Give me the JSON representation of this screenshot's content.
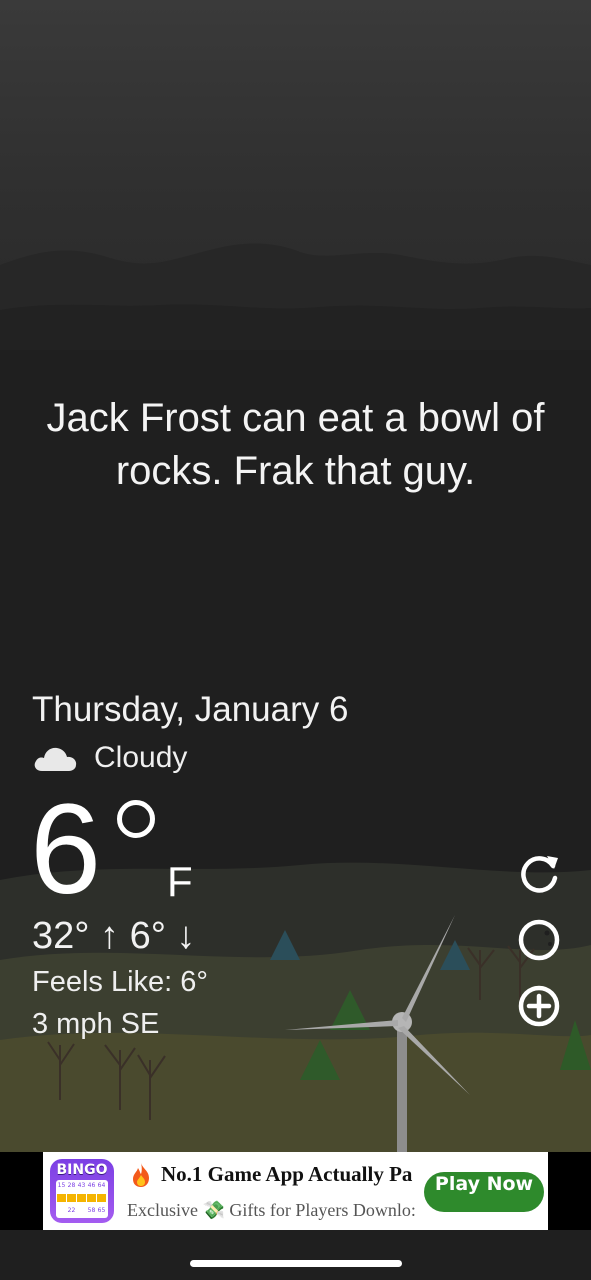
{
  "message": "Jack Frost can eat a bowl of rocks. Frak that guy.",
  "weather": {
    "date": "Thursday, January 6",
    "condition": "Cloudy",
    "condition_icon": "cloud-icon",
    "temperature": "6",
    "unit": "F",
    "high_low": "32° ↑ 6° ↓",
    "feels_like": "Feels Like: 6°",
    "wind": "3 mph SE"
  },
  "side_actions": [
    {
      "icon": "refresh-icon"
    },
    {
      "icon": "theme-icon"
    },
    {
      "icon": "add-icon"
    }
  ],
  "ad": {
    "app_icon_text": "BINGO",
    "title": "No.1 Game App Actually Pa",
    "subtitle": "Exclusive 💸 Gifts for Players Downlo:",
    "cta": "Play Now",
    "cta_color": "#2e8a2c"
  },
  "colors": {
    "background": "#1f1f1f",
    "text": "#ffffff"
  }
}
